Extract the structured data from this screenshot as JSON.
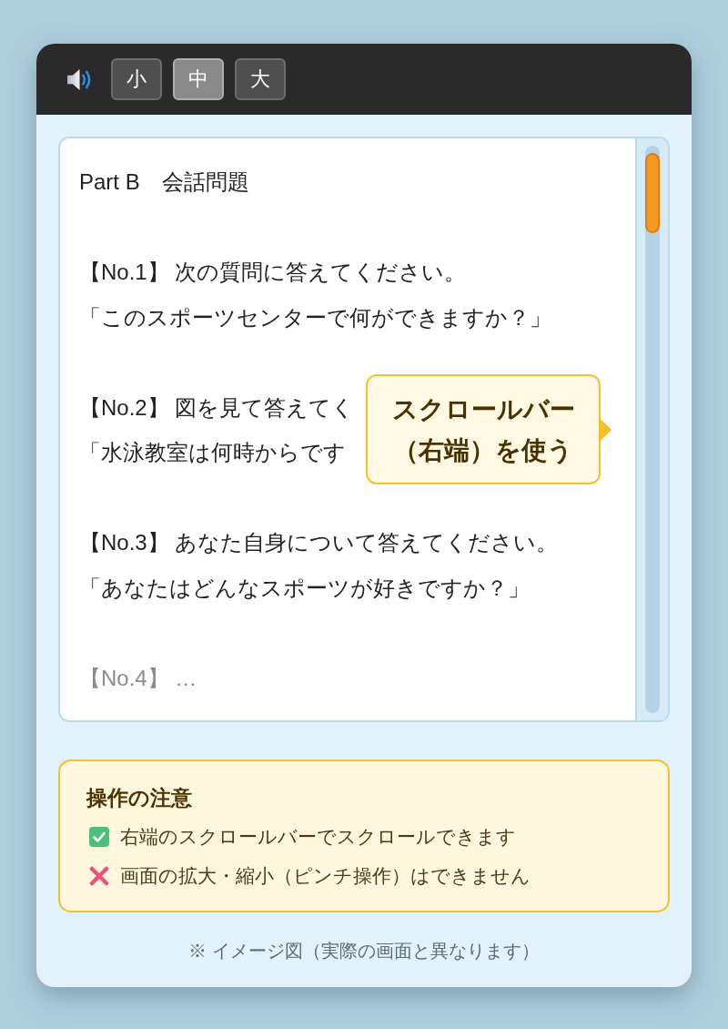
{
  "toolbar": {
    "size_buttons": [
      {
        "label": "小",
        "selected": false
      },
      {
        "label": "中",
        "selected": true
      },
      {
        "label": "大",
        "selected": false
      }
    ]
  },
  "panel": {
    "title": "Part B　会話問題",
    "questions": [
      {
        "prompt": "【No.1】 次の質問に答えてください。",
        "question": "「このスポーツセンターで何ができますか？」",
        "faded": false
      },
      {
        "prompt": "【No.2】 図を見て答えてく",
        "question": "「水泳教室は何時からです",
        "faded": false
      },
      {
        "prompt": "【No.3】 あなた自身について答えてください。",
        "question": "「あなたはどんなスポーツが好きですか？」",
        "faded": false
      },
      {
        "prompt": "【No.4】 …",
        "faded": true
      }
    ],
    "callout": {
      "lines": [
        "スクロールバー",
        "（右端）を使う"
      ]
    }
  },
  "notice": {
    "title": "操作の注意",
    "items": [
      {
        "kind": "ok",
        "text": "右端のスクロールバーでスクロールできます"
      },
      {
        "kind": "ng",
        "text": "画面の拡大・縮小（ピンチ操作）はできません"
      }
    ]
  },
  "footnote": "※ イメージ図（実際の画面と異なります）"
}
